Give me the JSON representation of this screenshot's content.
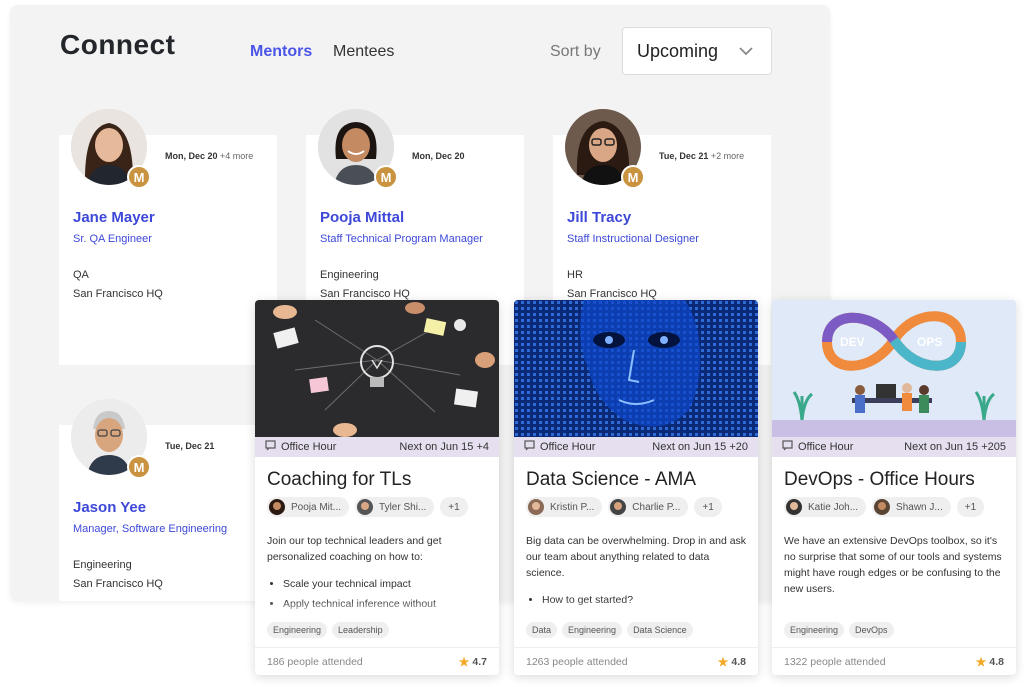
{
  "connect": {
    "title": "Connect",
    "tabs": {
      "mentors": "Mentors",
      "mentees": "Mentees"
    },
    "sort_label": "Sort by",
    "sort_value": "Upcoming",
    "accent": "#4a55e8"
  },
  "mentors": [
    {
      "date": "Mon, Dec 20",
      "more": "+4 more",
      "badge": "M",
      "name": "Jane Mayer",
      "role": "Sr. QA Engineer",
      "dept": "QA",
      "location": "San Francisco HQ"
    },
    {
      "date": "Mon, Dec 20",
      "more": "",
      "badge": "M",
      "name": "Pooja Mittal",
      "role": "Staff Technical Program Manager",
      "dept": "Engineering",
      "location": "San Francisco HQ"
    },
    {
      "date": "Tue, Dec 21",
      "more": "+2 more",
      "badge": "M",
      "name": "Jill Tracy",
      "role": "Staff Instructional Designer",
      "dept": "HR",
      "location": "San Francisco HQ"
    },
    {
      "date": "Tue, Dec 21",
      "more": "",
      "badge": "M",
      "name": "Jason Yee",
      "role": "Manager, Software Engineering",
      "dept": "Engineering",
      "location": "San Francisco HQ"
    }
  ],
  "office_hours": [
    {
      "type": "Office Hour",
      "next": "Next on Jun 15",
      "next_more": "+4",
      "title": "Coaching for TLs",
      "hosts": [
        "Pooja Mit...",
        "Tyler Shi..."
      ],
      "host_more": "+1",
      "desc": "Join our top technical leaders and get personalized coaching on how to:",
      "bullets": [
        "Scale your technical impact",
        "Apply technical inference without"
      ],
      "tags": [
        "Engineering",
        "Leadership"
      ],
      "attended": "186 people attended",
      "rating": "4.7"
    },
    {
      "type": "Office Hour",
      "next": "Next on Jun 15",
      "next_more": "+20",
      "title": "Data Science - AMA",
      "hosts": [
        "Kristin P...",
        "Charlie P..."
      ],
      "host_more": "+1",
      "desc": "Big data can be overwhelming. Drop in and ask our team about anything related to data science.",
      "bullets": [
        "How to get started?"
      ],
      "tags": [
        "Data",
        "Engineering",
        "Data Science"
      ],
      "attended": "1263 people attended",
      "rating": "4.8"
    },
    {
      "type": "Office Hour",
      "next": "Next on Jun 15",
      "next_more": "+205",
      "title": "DevOps - Office Hours",
      "hosts": [
        "Katie Joh...",
        "Shawn J..."
      ],
      "host_more": "+1",
      "desc": "We have an extensive DevOps toolbox, so it's no surprise that some of our tools and systems might have rough edges or be confusing to the new users.",
      "bullets": [],
      "tags": [
        "Engineering",
        "DevOps"
      ],
      "attended": "1322 people attended",
      "rating": "4.8",
      "logo_left": "DEV",
      "logo_right": "OPS"
    }
  ]
}
